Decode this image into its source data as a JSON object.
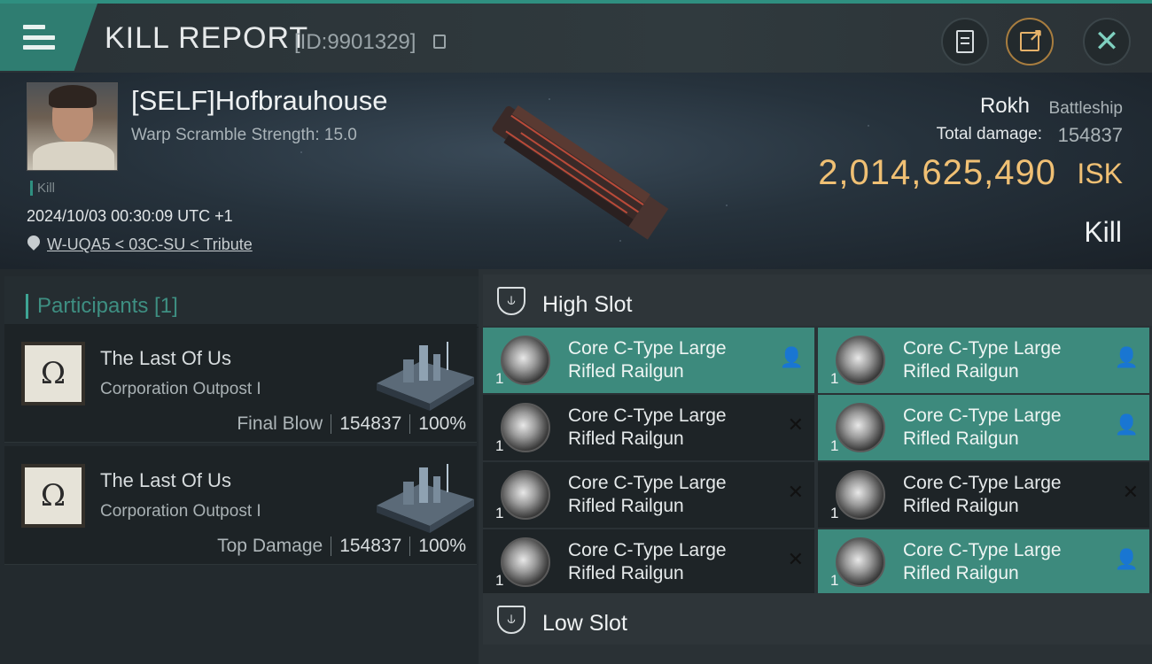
{
  "header": {
    "title": "KILL REPORT",
    "report_id": "[ID:9901329]"
  },
  "victim": {
    "name": "[SELF]Hofbrauhouse",
    "warp_scramble": "Warp Scramble Strength: 15.0",
    "tag": "Kill",
    "datetime": "2024/10/03 00:30:09 UTC +1",
    "location": "W-UQA5 < 03C-SU < Tribute",
    "ship_name": "Rokh",
    "ship_class": "Battleship",
    "total_damage_label": "Total damage:",
    "total_damage_value": "154837",
    "isk_value": "2,014,625,490",
    "isk_unit": "ISK",
    "result": "Kill"
  },
  "participants": {
    "title": "Participants [1]",
    "rows": [
      {
        "logo": "Ω",
        "name": "The Last Of Us",
        "structure": "Corporation Outpost I",
        "role": "Final Blow",
        "damage": "154837",
        "percent": "100%"
      },
      {
        "logo": "Ω",
        "name": "The Last Of Us",
        "structure": "Corporation Outpost I",
        "role": "Top Damage",
        "damage": "154837",
        "percent": "100%"
      }
    ]
  },
  "slots": {
    "high_slot_label": "High Slot",
    "low_slot_label": "Low Slot",
    "high_items": [
      {
        "line1": "Core C-Type Large",
        "line2": "Rifled Railgun",
        "qty": "1",
        "status": "dropped",
        "glyph": "👤"
      },
      {
        "line1": "Core C-Type Large",
        "line2": "Rifled Railgun",
        "qty": "1",
        "status": "dropped",
        "glyph": "👤"
      },
      {
        "line1": "Core C-Type Large",
        "line2": "Rifled Railgun",
        "qty": "1",
        "status": "destroyed",
        "glyph": "✕"
      },
      {
        "line1": "Core C-Type Large",
        "line2": "Rifled Railgun",
        "qty": "1",
        "status": "dropped",
        "glyph": "👤"
      },
      {
        "line1": "Core C-Type Large",
        "line2": "Rifled Railgun",
        "qty": "1",
        "status": "destroyed",
        "glyph": "✕"
      },
      {
        "line1": "Core C-Type Large",
        "line2": "Rifled Railgun",
        "qty": "1",
        "status": "destroyed",
        "glyph": "✕"
      },
      {
        "line1": "Core C-Type Large",
        "line2": "Rifled Railgun",
        "qty": "1",
        "status": "destroyed",
        "glyph": "✕"
      },
      {
        "line1": "Core C-Type Large",
        "line2": "Rifled Railgun",
        "qty": "1",
        "status": "dropped",
        "glyph": "👤"
      }
    ]
  },
  "icons": {
    "menu": "menu-icon",
    "report": "document-icon",
    "share": "share-icon",
    "close": "close-icon",
    "location": "location-pin-icon",
    "slot": "high-slot-icon"
  },
  "colors": {
    "accent": "#2f8f80",
    "isk": "#f0c074",
    "dropped_bg": "#3d8a7d"
  }
}
